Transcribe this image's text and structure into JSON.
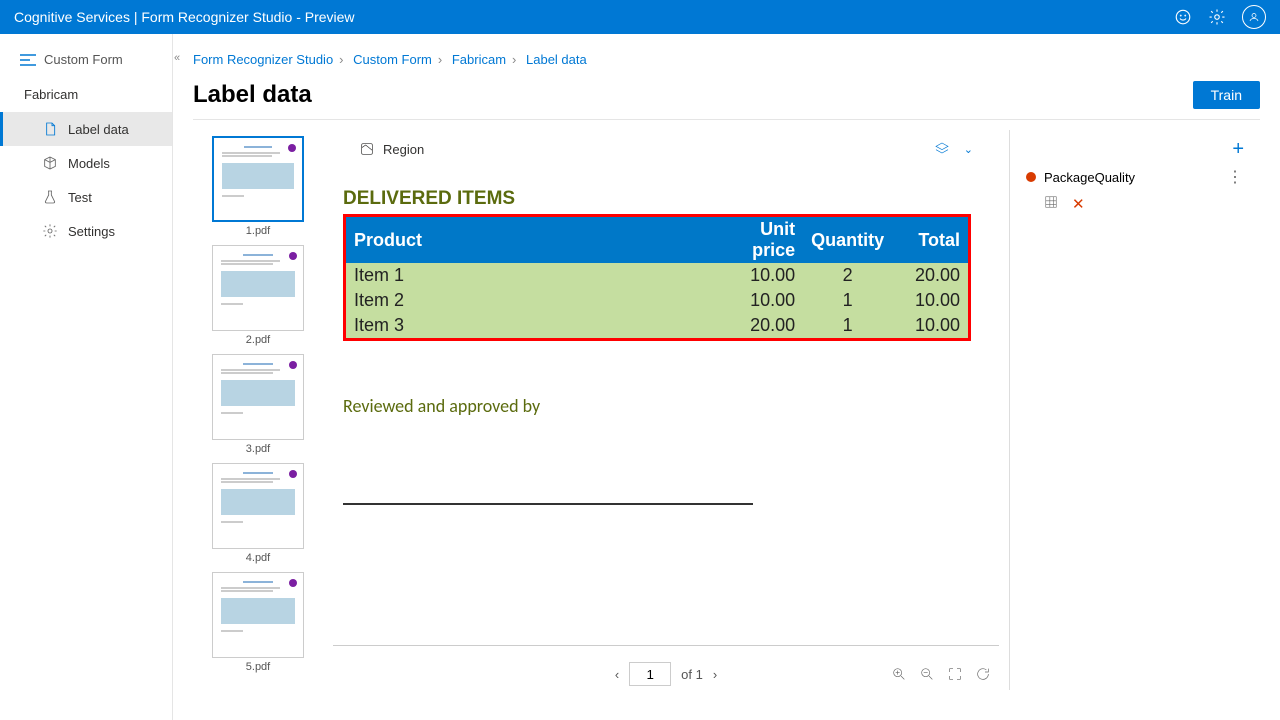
{
  "header": {
    "title": "Cognitive Services | Form Recognizer Studio - Preview"
  },
  "sidebar": {
    "head": "Custom Form",
    "project": "Fabricam",
    "items": [
      {
        "label": "Label data"
      },
      {
        "label": "Models"
      },
      {
        "label": "Test"
      },
      {
        "label": "Settings"
      }
    ]
  },
  "breadcrumb": [
    "Form Recognizer Studio",
    "Custom Form",
    "Fabricam",
    "Label data"
  ],
  "page": {
    "title": "Label data",
    "train": "Train"
  },
  "thumbs": [
    "1.pdf",
    "2.pdf",
    "3.pdf",
    "4.pdf",
    "5.pdf"
  ],
  "toolbar": {
    "region": "Region"
  },
  "document": {
    "section": "DELIVERED ITEMS",
    "headers": [
      "Product",
      "Unit price",
      "Quantity",
      "Total"
    ],
    "rows": [
      {
        "p": "Item 1",
        "u": "10.00",
        "q": "2",
        "t": "20.00"
      },
      {
        "p": "Item 2",
        "u": "10.00",
        "q": "1",
        "t": "10.00"
      },
      {
        "p": "Item 3",
        "u": "20.00",
        "q": "1",
        "t": "10.00"
      }
    ],
    "reviewed": "Reviewed and approved by"
  },
  "pager": {
    "page": "1",
    "of": "of 1"
  },
  "tags": {
    "name": "PackageQuality"
  }
}
